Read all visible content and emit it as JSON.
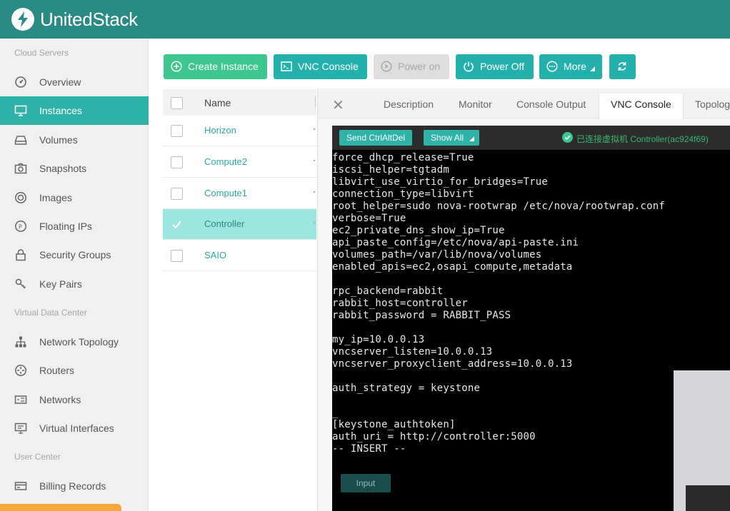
{
  "brand": {
    "name": "UnitedStack"
  },
  "sidebar": {
    "sections": [
      {
        "label": "Cloud Servers"
      },
      {
        "label": "Virtual Data Center"
      },
      {
        "label": "User Center"
      }
    ],
    "items": [
      {
        "label": "Overview",
        "icon": "overview-icon",
        "active": false
      },
      {
        "label": "Instances",
        "icon": "monitor-icon",
        "active": true
      },
      {
        "label": "Volumes",
        "icon": "disk-icon",
        "active": false
      },
      {
        "label": "Snapshots",
        "icon": "camera-icon",
        "active": false
      },
      {
        "label": "Images",
        "icon": "disc-icon",
        "active": false
      },
      {
        "label": "Floating IPs",
        "icon": "location-pin-icon",
        "active": false
      },
      {
        "label": "Security Groups",
        "icon": "lock-icon",
        "active": false
      },
      {
        "label": "Key Pairs",
        "icon": "key-icon",
        "active": false
      },
      {
        "label": "Network Topology",
        "icon": "topology-icon",
        "active": false
      },
      {
        "label": "Routers",
        "icon": "router-icon",
        "active": false
      },
      {
        "label": "Networks",
        "icon": "network-icon",
        "active": false
      },
      {
        "label": "Virtual Interfaces",
        "icon": "interface-icon",
        "active": false
      },
      {
        "label": "Billing Records",
        "icon": "billing-icon",
        "active": false
      }
    ]
  },
  "toolbar": {
    "create_instance": "Create Instance",
    "vnc_console": "VNC Console",
    "power_on": "Power on",
    "power_off": "Power Off",
    "more": "More",
    "refresh_icon": "refresh-icon"
  },
  "table": {
    "name_header": "Name",
    "rows": [
      {
        "name": "Horizon",
        "checked": false
      },
      {
        "name": "Compute2",
        "checked": false
      },
      {
        "name": "Compute1",
        "checked": false
      },
      {
        "name": "Controller",
        "checked": true
      },
      {
        "name": "SAIO",
        "checked": false
      }
    ]
  },
  "detail": {
    "tabs": [
      "Description",
      "Monitor",
      "Console Output",
      "VNC Console",
      "Topology"
    ],
    "active_tab": "VNC Console"
  },
  "vnc": {
    "send_ctrl_alt_del": "Send CtrlAltDel",
    "show_all": "Show All",
    "status": "已连接虚拟机 Controller(ac924f69)",
    "input_button": "Input",
    "lines": [
      "force_dhcp_release=True",
      "iscsi_helper=tgtadm",
      "libvirt_use_virtio_for_bridges=True",
      "connection_type=libvirt",
      "root_helper=sudo nova-rootwrap /etc/nova/rootwrap.conf",
      "verbose=True",
      "ec2_private_dns_show_ip=True",
      "api_paste_config=/etc/nova/api-paste.ini",
      "volumes_path=/var/lib/nova/volumes",
      "enabled_apis=ec2,osapi_compute,metadata",
      "",
      "rpc_backend=rabbit",
      "rabbit_host=controller",
      "rabbit_password = RABBIT_PASS",
      "",
      "my_ip=10.0.0.13",
      "vncserver_listen=10.0.0.13",
      "vncserver_proxyclient_address=10.0.0.13",
      "",
      "auth_strategy = keystone",
      "",
      "_",
      "[keystone_authtoken]",
      "auth_uri = http://controller:5000",
      "-- INSERT --"
    ]
  },
  "colors": {
    "topbar": "#2a8a86",
    "accent": "#2fb3a8",
    "create_button": "#3dc690",
    "selected_row": "#9be6e0"
  }
}
